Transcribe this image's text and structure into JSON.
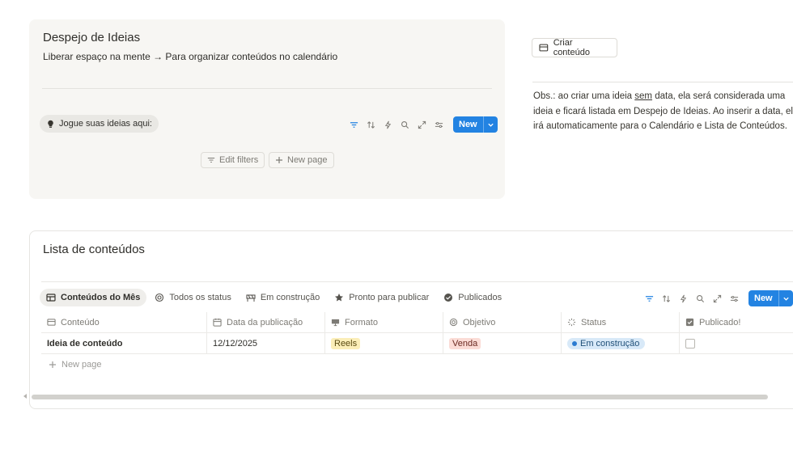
{
  "ideas": {
    "title": "Despejo de Ideias",
    "subtitle": "Liberar espaço na mente → Para organizar conteúdos no calendário",
    "chip_label": "Jogue suas ideias aqui:",
    "new_label": "New",
    "edit_filters_label": "Edit filters",
    "new_page_label": "New page"
  },
  "side": {
    "criar_label": "Criar conteúdo",
    "obs_before": "Obs.: ao criar uma ideia ",
    "obs_underlined": "sem",
    "obs_after": " data, ela será considerada uma ideia e ficará listada em Despejo de Ideias. Ao inserir a data, ela irá automaticamente para o Calendário e Lista de Conteúdos."
  },
  "list": {
    "title": "Lista de conteúdos",
    "tabs": [
      {
        "label": "Conteúdos do Mês",
        "icon": "table-icon",
        "active": true
      },
      {
        "label": "Todos os status",
        "icon": "target-icon",
        "active": false
      },
      {
        "label": "Em construção",
        "icon": "construction-icon",
        "active": false
      },
      {
        "label": "Pronto para publicar",
        "icon": "star-icon",
        "active": false
      },
      {
        "label": "Publicados",
        "icon": "check-circle-icon",
        "active": false
      }
    ],
    "new_label": "New",
    "columns": [
      "Conteúdo",
      "Data da publicação",
      "Formato",
      "Objetivo",
      "Status",
      "Publicado!"
    ],
    "rows": [
      {
        "conteudo": "Ideia de conteúdo",
        "data": "12/12/2025",
        "formato": "Reels",
        "objetivo": "Venda",
        "status": "Em construção",
        "publicado": false
      }
    ],
    "new_page_label": "New page"
  },
  "colors": {
    "accent": "#2383e2",
    "tag_yellow": "#fbeeb8",
    "tag_red": "#fbdcd6",
    "status_blue": "#d8e9f8"
  }
}
